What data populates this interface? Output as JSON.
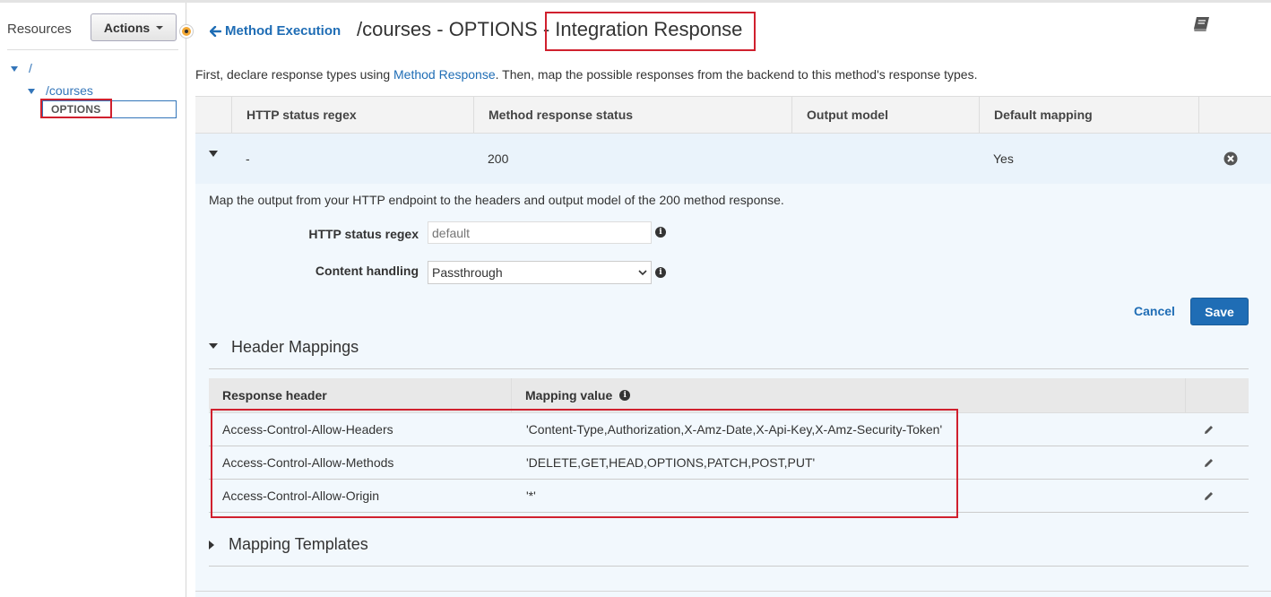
{
  "sidebar": {
    "title": "Resources",
    "actions_label": "Actions",
    "tree": {
      "root": "/",
      "courses": "/courses",
      "options": "OPTIONS"
    }
  },
  "header": {
    "back_label": "Method Execution",
    "title_prefix": "/courses - OPTIONS -",
    "title_highlight": "Integration Response"
  },
  "intro": {
    "before": "First, declare response types using ",
    "link": "Method Response",
    "after": ". Then, map the possible responses from the backend to this method's response types."
  },
  "response_table": {
    "columns": [
      "HTTP status regex",
      "Method response status",
      "Output model",
      "Default mapping"
    ],
    "rows": [
      {
        "regex": "-",
        "status": "200",
        "model": "",
        "default": "Yes"
      }
    ]
  },
  "detail": {
    "description": "Map the output from your HTTP endpoint to the headers and output model of the 200 method response.",
    "status_regex_label": "HTTP status regex",
    "status_regex_placeholder": "default",
    "content_handling_label": "Content handling",
    "content_handling_value": "Passthrough",
    "cancel_label": "Cancel",
    "save_label": "Save"
  },
  "header_mappings": {
    "title": "Header Mappings",
    "columns": [
      "Response header",
      "Mapping value"
    ],
    "rows": [
      {
        "header": "Access-Control-Allow-Headers",
        "value": "'Content-Type,Authorization,X-Amz-Date,X-Api-Key,X-Amz-Security-Token'"
      },
      {
        "header": "Access-Control-Allow-Methods",
        "value": "'DELETE,GET,HEAD,OPTIONS,PATCH,POST,PUT'"
      },
      {
        "header": "Access-Control-Allow-Origin",
        "value": "'*'"
      }
    ]
  },
  "mapping_templates": {
    "title": "Mapping Templates"
  },
  "colors": {
    "accent": "#1f6db5",
    "highlight_border": "#d0202e",
    "row_selected": "#eaf3fb",
    "detail_bg": "#f2f8fd"
  },
  "icons": [
    "book-icon",
    "arrow-left-icon",
    "info-icon",
    "remove-circle-icon",
    "pencil-icon",
    "caret-down-icon",
    "caret-right-icon",
    "panel-collapse-handle"
  ]
}
